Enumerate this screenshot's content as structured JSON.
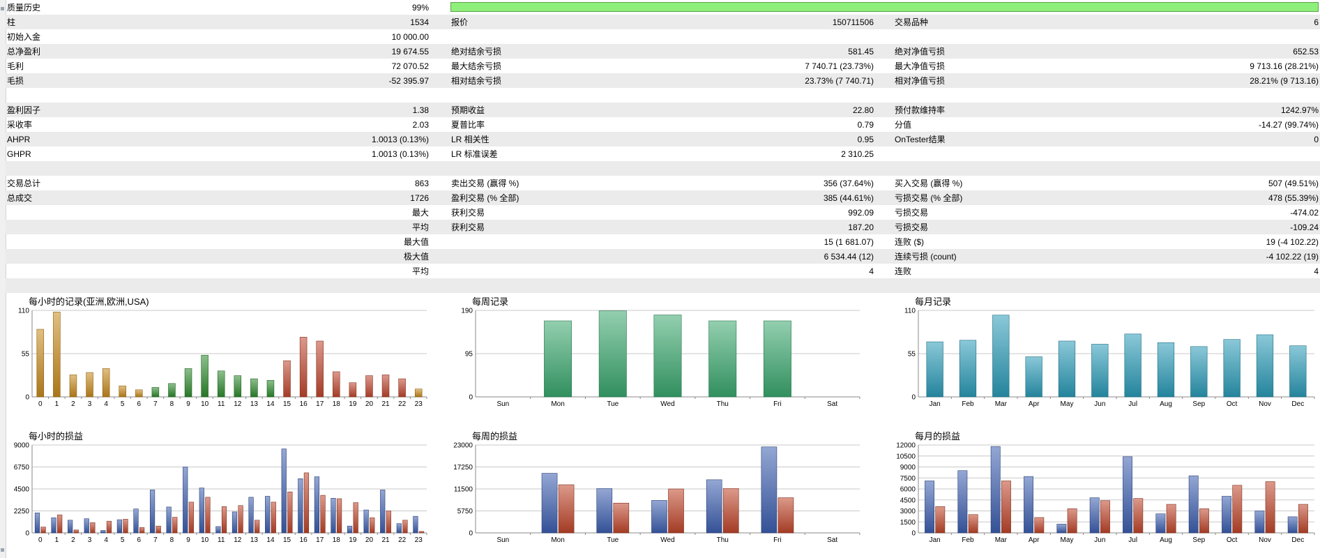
{
  "stats": {
    "quality": {
      "label": "质量历史",
      "value": "99%",
      "fraction": 0.99
    },
    "rows": [
      {
        "alt": true,
        "l1": "柱",
        "v1": "1534",
        "l2": "报价",
        "v2": "150711506",
        "l3": "交易品种",
        "v3": "6"
      },
      {
        "alt": false,
        "l1": "初始入金",
        "v1": "10 000.00",
        "l2": "",
        "v2": "",
        "l3": "",
        "v3": ""
      },
      {
        "alt": true,
        "l1": "总净盈利",
        "v1": "19 674.55",
        "l2": "绝对结余亏损",
        "v2": "581.45",
        "l3": "绝对净值亏损",
        "v3": "652.53"
      },
      {
        "alt": false,
        "l1": "毛利",
        "v1": "72 070.52",
        "l2": "最大结余亏损",
        "v2": "7 740.71 (23.73%)",
        "l3": "最大净值亏损",
        "v3": "9 713.16 (28.21%)"
      },
      {
        "alt": true,
        "l1": "毛损",
        "v1": "-52 395.97",
        "l2": "相对结余亏损",
        "v2": "23.73% (7 740.71)",
        "l3": "相对净值亏损",
        "v3": "28.21% (9 713.16)"
      },
      {
        "alt": false,
        "l1": "",
        "v1": "",
        "l2": "",
        "v2": "",
        "l3": "",
        "v3": ""
      },
      {
        "alt": true,
        "l1": "盈利因子",
        "v1": "1.38",
        "l2": "预期收益",
        "v2": "22.80",
        "l3": "预付款维持率",
        "v3": "1242.97%"
      },
      {
        "alt": false,
        "l1": "采收率",
        "v1": "2.03",
        "l2": "夏普比率",
        "v2": "0.79",
        "l3": "分值",
        "v3": "-14.27 (99.74%)"
      },
      {
        "alt": true,
        "l1": "AHPR",
        "v1": "1.0013 (0.13%)",
        "l2": "LR 相关性",
        "v2": "0.95",
        "l3": "OnTester结果",
        "v3": "0"
      },
      {
        "alt": false,
        "l1": "GHPR",
        "v1": "1.0013 (0.13%)",
        "l2": "LR 标准误差",
        "v2": "2 310.25",
        "l3": "",
        "v3": ""
      },
      {
        "alt": true,
        "l1": "",
        "v1": "",
        "l2": "",
        "v2": "",
        "l3": "",
        "v3": ""
      },
      {
        "alt": false,
        "l1": "交易总计",
        "v1": "863",
        "l2": "卖出交易 (赢得 %)",
        "v2": "356 (37.64%)",
        "l3": "买入交易 (赢得 %)",
        "v3": "507 (49.51%)"
      },
      {
        "alt": true,
        "l1": "总成交",
        "v1": "1726",
        "l2": "盈利交易 (% 全部)",
        "v2": "385 (44.61%)",
        "l3": "亏损交易 (% 全部)",
        "v3": "478 (55.39%)"
      },
      {
        "alt": false,
        "l1": "",
        "v1": "最大",
        "l2": "获利交易",
        "v2": "992.09",
        "l3": "亏损交易",
        "v3": "-474.02"
      },
      {
        "alt": true,
        "l1": "",
        "v1": "平均",
        "l2": "获利交易",
        "v2": "187.20",
        "l3": "亏损交易",
        "v3": "-109.24"
      },
      {
        "alt": false,
        "l1": "",
        "v1": "最大值",
        "l2": "",
        "v2": "15 (1 681.07)",
        "l3": "连败 ($)",
        "v3": "19 (-4 102.22)"
      },
      {
        "alt": true,
        "l1": "",
        "v1": "极大值",
        "l2": "",
        "v2": "6 534.44 (12)",
        "l3": "连续亏损 (count)",
        "v3": "-4 102.22 (19)"
      },
      {
        "alt": false,
        "l1": "",
        "v1": "平均",
        "l2": "",
        "v2": "4",
        "l3": "连败",
        "v3": "4"
      },
      {
        "alt": true,
        "l1": "",
        "v1": "",
        "l2": "",
        "v2": "",
        "l3": "",
        "v3": ""
      }
    ]
  },
  "chart_data": [
    {
      "type": "bar",
      "title": "每小时的记录(亚洲,欧洲,USA)",
      "ylim": [
        0,
        110
      ],
      "yticks": [
        "0",
        "55",
        "110"
      ],
      "categories": [
        "0",
        "1",
        "2",
        "3",
        "4",
        "5",
        "6",
        "7",
        "8",
        "9",
        "10",
        "11",
        "12",
        "13",
        "14",
        "15",
        "16",
        "17",
        "18",
        "19",
        "20",
        "21",
        "22",
        "23"
      ],
      "values": [
        86,
        108,
        28,
        31,
        36,
        14,
        9,
        12,
        17,
        36,
        53,
        33,
        27,
        23,
        21,
        46,
        76,
        71,
        32,
        18,
        27,
        28,
        23,
        10
      ],
      "colors": [
        "#c88a1c",
        "#c88a1c",
        "#c88a1c",
        "#c88a1c",
        "#c88a1c",
        "#c88a1c",
        "#c88a1c",
        "#2e8b2e",
        "#2e8b2e",
        "#2e8b2e",
        "#2e8b2e",
        "#2e8b2e",
        "#2e8b2e",
        "#2e8b2e",
        "#2e8b2e",
        "#c0462e",
        "#c0462e",
        "#c0462e",
        "#c0462e",
        "#c0462e",
        "#c0462e",
        "#c0462e",
        "#c0462e",
        "#c88a1c"
      ]
    },
    {
      "type": "bar",
      "title": "每周记录",
      "ylim": [
        0,
        190
      ],
      "yticks": [
        "0",
        "95",
        "190"
      ],
      "categories": [
        "Sun",
        "Mon",
        "Tue",
        "Wed",
        "Thu",
        "Fri",
        "Sat"
      ],
      "values": [
        0,
        167,
        189,
        180,
        167,
        167,
        0
      ],
      "color": "#3aa86e"
    },
    {
      "type": "bar",
      "title": "每月记录",
      "ylim": [
        0,
        110
      ],
      "yticks": [
        "0",
        "55",
        "110"
      ],
      "categories": [
        "Jan",
        "Feb",
        "Mar",
        "Apr",
        "May",
        "Jun",
        "Jul",
        "Aug",
        "Sep",
        "Oct",
        "Nov",
        "Dec"
      ],
      "values": [
        70,
        72,
        104,
        51,
        71,
        67,
        80,
        69,
        64,
        73,
        79,
        65
      ],
      "color": "#2a9bb8"
    },
    {
      "type": "bar",
      "title": "每小时的损益",
      "ylim": [
        0,
        9000
      ],
      "yticks": [
        "0",
        "2250",
        "4500",
        "6750",
        "9000"
      ],
      "categories": [
        "0",
        "1",
        "2",
        "3",
        "4",
        "5",
        "6",
        "7",
        "8",
        "9",
        "10",
        "11",
        "12",
        "13",
        "14",
        "15",
        "16",
        "17",
        "18",
        "19",
        "20",
        "21",
        "22",
        "23"
      ],
      "series": [
        {
          "color": "#3d5fb0",
          "values": [
            2050,
            1550,
            1300,
            1450,
            250,
            1350,
            2450,
            4400,
            2650,
            6750,
            4600,
            650,
            2150,
            3650,
            3750,
            8600,
            5550,
            5750,
            3550,
            700,
            2350,
            4400,
            950,
            1700
          ]
        },
        {
          "color": "#c0452a",
          "values": [
            600,
            1850,
            300,
            1050,
            1200,
            1400,
            550,
            700,
            1600,
            3150,
            3650,
            2700,
            2800,
            1300,
            3150,
            4200,
            6150,
            3850,
            3500,
            3100,
            1550,
            2250,
            1300,
            150
          ]
        }
      ]
    },
    {
      "type": "bar",
      "title": "每周的损益",
      "ylim": [
        0,
        23000
      ],
      "yticks": [
        "0",
        "5750",
        "11500",
        "17250",
        "23000"
      ],
      "categories": [
        "Sun",
        "Mon",
        "Tue",
        "Wed",
        "Thu",
        "Fri",
        "Sat"
      ],
      "series": [
        {
          "color": "#3d5fb0",
          "values": [
            0,
            15600,
            11600,
            8500,
            13900,
            22500,
            0
          ]
        },
        {
          "color": "#c0452a",
          "values": [
            0,
            12600,
            7800,
            11500,
            11600,
            9200,
            0
          ]
        }
      ]
    },
    {
      "type": "bar",
      "title": "每月的损益",
      "ylim": [
        0,
        12000
      ],
      "yticks": [
        "0",
        "1500",
        "3000",
        "4500",
        "6000",
        "7500",
        "9000",
        "10500",
        "12000"
      ],
      "categories": [
        "Jan",
        "Feb",
        "Mar",
        "Apr",
        "May",
        "Jun",
        "Jul",
        "Aug",
        "Sep",
        "Oct",
        "Nov",
        "Dec"
      ],
      "series": [
        {
          "color": "#3d5fb0",
          "values": [
            7100,
            8500,
            11800,
            7700,
            1200,
            4800,
            10400,
            2600,
            7800,
            5000,
            3000,
            2200
          ]
        },
        {
          "color": "#c0452a",
          "values": [
            3600,
            2500,
            7100,
            2100,
            3300,
            4400,
            4700,
            3900,
            3300,
            6500,
            7000,
            3900
          ]
        }
      ]
    }
  ]
}
